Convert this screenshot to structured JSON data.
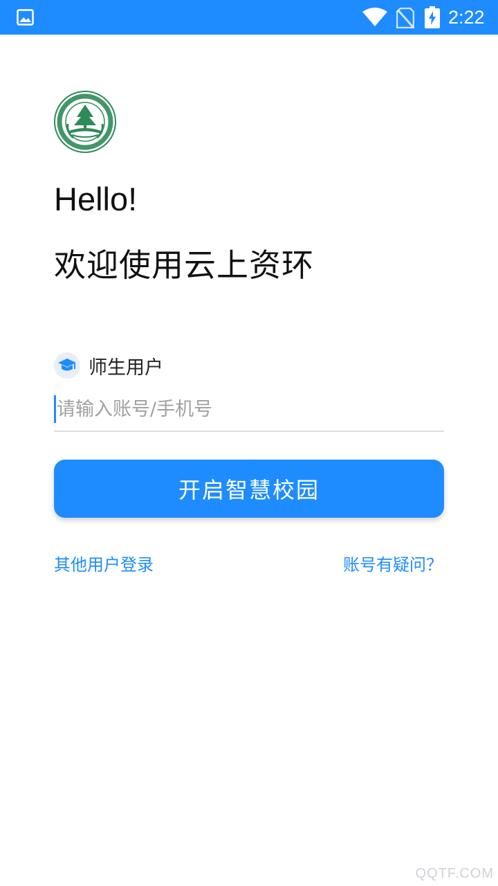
{
  "status_bar": {
    "time": "2:22",
    "icons": [
      "image-notification-icon",
      "wifi-icon",
      "no-sim-icon",
      "battery-charging-icon"
    ]
  },
  "logo": {
    "icon": "college-emblem-icon"
  },
  "greeting": "Hello!",
  "welcome": "欢迎使用云上资环",
  "user_type": {
    "label": "师生用户",
    "icon": "graduation-cap-icon"
  },
  "account_input": {
    "value": "",
    "placeholder": "请输入账号/手机号"
  },
  "primary_button": {
    "label": "开启智慧校园"
  },
  "links": {
    "other_login": "其他用户登录",
    "account_question": "账号有疑问？"
  },
  "watermark": "QQTF.COM",
  "colors": {
    "accent": "#1E8CFF",
    "text": "#111111",
    "placeholder": "#A0A0A0"
  }
}
